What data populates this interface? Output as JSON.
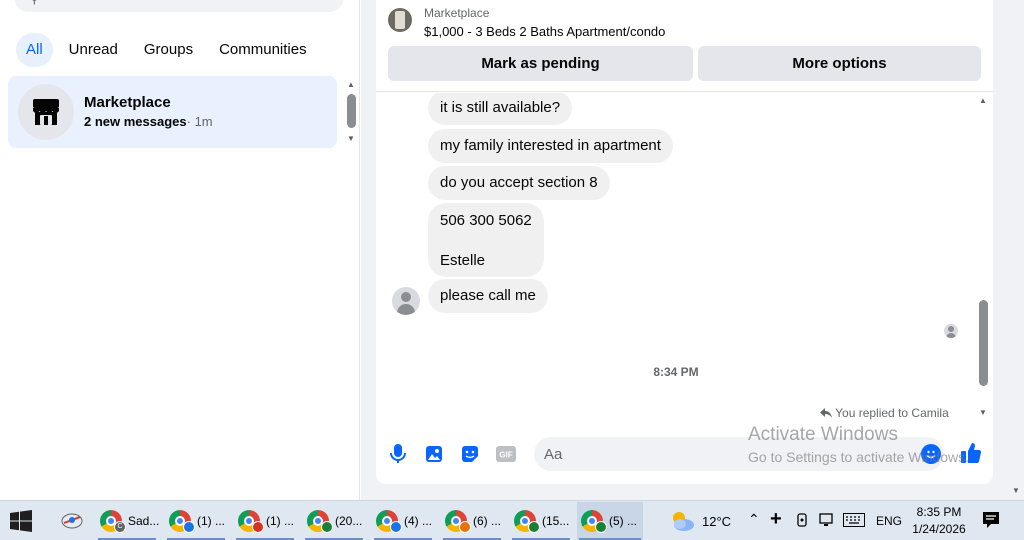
{
  "sidebar": {
    "filters": [
      "All",
      "Unread",
      "Groups",
      "Communities"
    ],
    "active_filter": "All",
    "conversation": {
      "title": "Marketplace",
      "subtitle": "2 new messages",
      "time": "· 1m"
    }
  },
  "chat": {
    "header": {
      "category": "Marketplace",
      "listing": "$1,000 - 3 Beds 2 Baths Apartment/condo",
      "pending_button": "Mark as pending",
      "more_button": "More options"
    },
    "messages": [
      {
        "text": "it is still available?"
      },
      {
        "text": "my family interested in apartment"
      },
      {
        "text": "do you accept section 8"
      },
      {
        "lines": [
          "506 300 5062",
          "Estelle"
        ]
      },
      {
        "text": "please call me"
      }
    ],
    "timestamp": "8:34 PM",
    "reply_note": "You replied to Camila",
    "composer": {
      "placeholder": "Aa"
    }
  },
  "watermark": {
    "line1": "Activate Windows",
    "line2": "Go to Settings to activate Windows."
  },
  "taskbar": {
    "apps": [
      {
        "label": "Sad...",
        "badge": "C",
        "badge_color": "#5f6368"
      },
      {
        "label": "(1) ...",
        "badge": "",
        "badge_color": "#1a73e8"
      },
      {
        "label": "(1) ...",
        "badge": "",
        "badge_color": "#d93025"
      },
      {
        "label": "(20...",
        "badge": "",
        "badge_color": "#188038"
      },
      {
        "label": "(4) ...",
        "badge": "",
        "badge_color": "#1a73e8"
      },
      {
        "label": "(6) ...",
        "badge": "",
        "badge_color": "#e8710a"
      },
      {
        "label": "(15...",
        "badge": "",
        "badge_color": "#188038"
      },
      {
        "label": "(5) ...",
        "badge": "",
        "badge_color": "#188038"
      }
    ],
    "weather": "12°C",
    "language": "ENG",
    "time": "8:35 PM",
    "date": "1/24/2026"
  },
  "colors": {
    "accent": "#0866ff",
    "bubble": "#f0f0f0",
    "selected_conversation": "#e8f1fd"
  }
}
